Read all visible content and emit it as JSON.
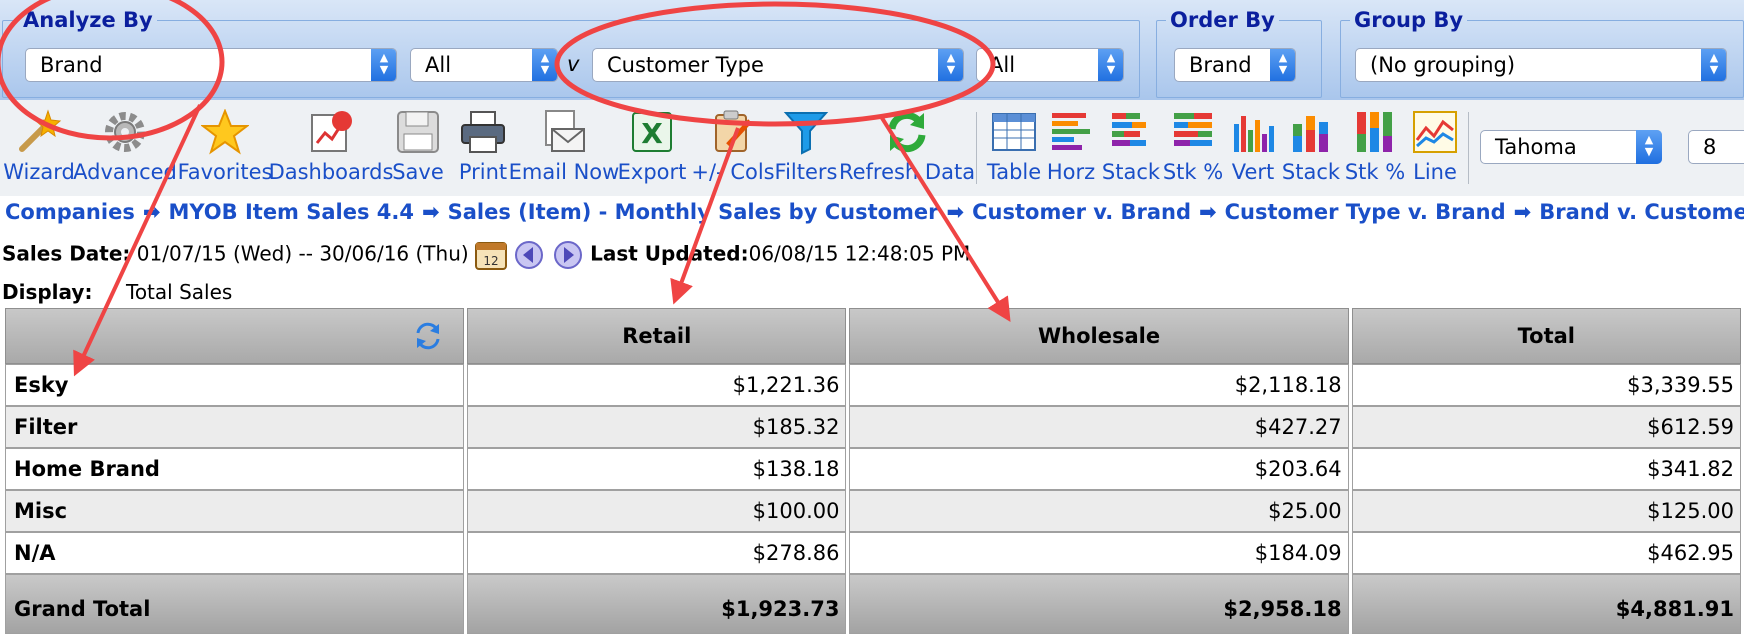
{
  "filters": {
    "analyze_by": {
      "legend": "Analyze By",
      "primary": "Brand",
      "primary_filter": "All",
      "connector": "v",
      "secondary": "Customer Type",
      "secondary_filter": "All"
    },
    "order_by": {
      "legend": "Order By",
      "value": "Brand"
    },
    "group_by": {
      "legend": "Group By",
      "value": "(No grouping)"
    }
  },
  "toolbar": {
    "buttons": [
      {
        "label": "Wizard",
        "icon": "wand-icon"
      },
      {
        "label": "Advanced",
        "icon": "gear-icon"
      },
      {
        "label": "Favorites",
        "icon": "star-icon"
      },
      {
        "label": "Dashboards",
        "icon": "dashboard-icon"
      },
      {
        "label": "Save",
        "icon": "floppy-icon"
      },
      {
        "label": "Print",
        "icon": "printer-icon"
      },
      {
        "label": "Email Now",
        "icon": "envelope-icon"
      },
      {
        "label": "Export",
        "icon": "excel-icon"
      },
      {
        "label": "+/- Cols",
        "icon": "clipboard-edit-icon"
      },
      {
        "label": "Filters",
        "icon": "funnel-icon"
      },
      {
        "label": "Refresh Data",
        "icon": "refresh-icon"
      }
    ],
    "views": [
      {
        "label": "Table",
        "icon": "table-icon"
      },
      {
        "label": "Horz",
        "icon": "horizontal-bar-icon"
      },
      {
        "label": "Stack",
        "icon": "stacked-bar-icon"
      },
      {
        "label": "Stk %",
        "icon": "stacked-percent-icon"
      },
      {
        "label": "Vert",
        "icon": "vertical-bar-icon"
      },
      {
        "label": "Stack",
        "icon": "stacked-column-icon"
      },
      {
        "label": "Stk %",
        "icon": "stacked-column-percent-icon"
      },
      {
        "label": "Line",
        "icon": "line-chart-icon"
      }
    ],
    "font_name": "Tahoma",
    "font_size": "8"
  },
  "breadcrumb": [
    "Companies",
    "MYOB Item Sales 4.4",
    "Sales (Item) - Monthly Sales by Customer",
    "Customer v. Brand",
    "Customer Type v. Brand",
    "Brand v. Customer Type"
  ],
  "info": {
    "sales_date_label": "Sales Date:",
    "sales_date_value": "01/07/15 (Wed) -- 30/06/16 (Thu)",
    "last_updated_label": "Last Updated:",
    "last_updated_value": "06/08/15 12:48:05 PM",
    "display_label": "Display:",
    "display_value": "Total Sales"
  },
  "table": {
    "columns": [
      "Retail",
      "Wholesale",
      "Total"
    ],
    "rows": [
      {
        "label": "Esky",
        "values": [
          "$1,221.36",
          "$2,118.18",
          "$3,339.55"
        ]
      },
      {
        "label": "Filter",
        "values": [
          "$185.32",
          "$427.27",
          "$612.59"
        ]
      },
      {
        "label": "Home Brand",
        "values": [
          "$138.18",
          "$203.64",
          "$341.82"
        ]
      },
      {
        "label": "Misc",
        "values": [
          "$100.00",
          "$25.00",
          "$125.00"
        ]
      },
      {
        "label": "N/A",
        "values": [
          "$278.86",
          "$184.09",
          "$462.95"
        ]
      }
    ],
    "total": {
      "label": "Grand Total",
      "values": [
        "$1,923.73",
        "$2,958.18",
        "$4,881.91"
      ]
    }
  },
  "colors": {
    "link": "#1a4fc8",
    "legend": "#0b1f9e",
    "annotation": "#ef4444"
  }
}
